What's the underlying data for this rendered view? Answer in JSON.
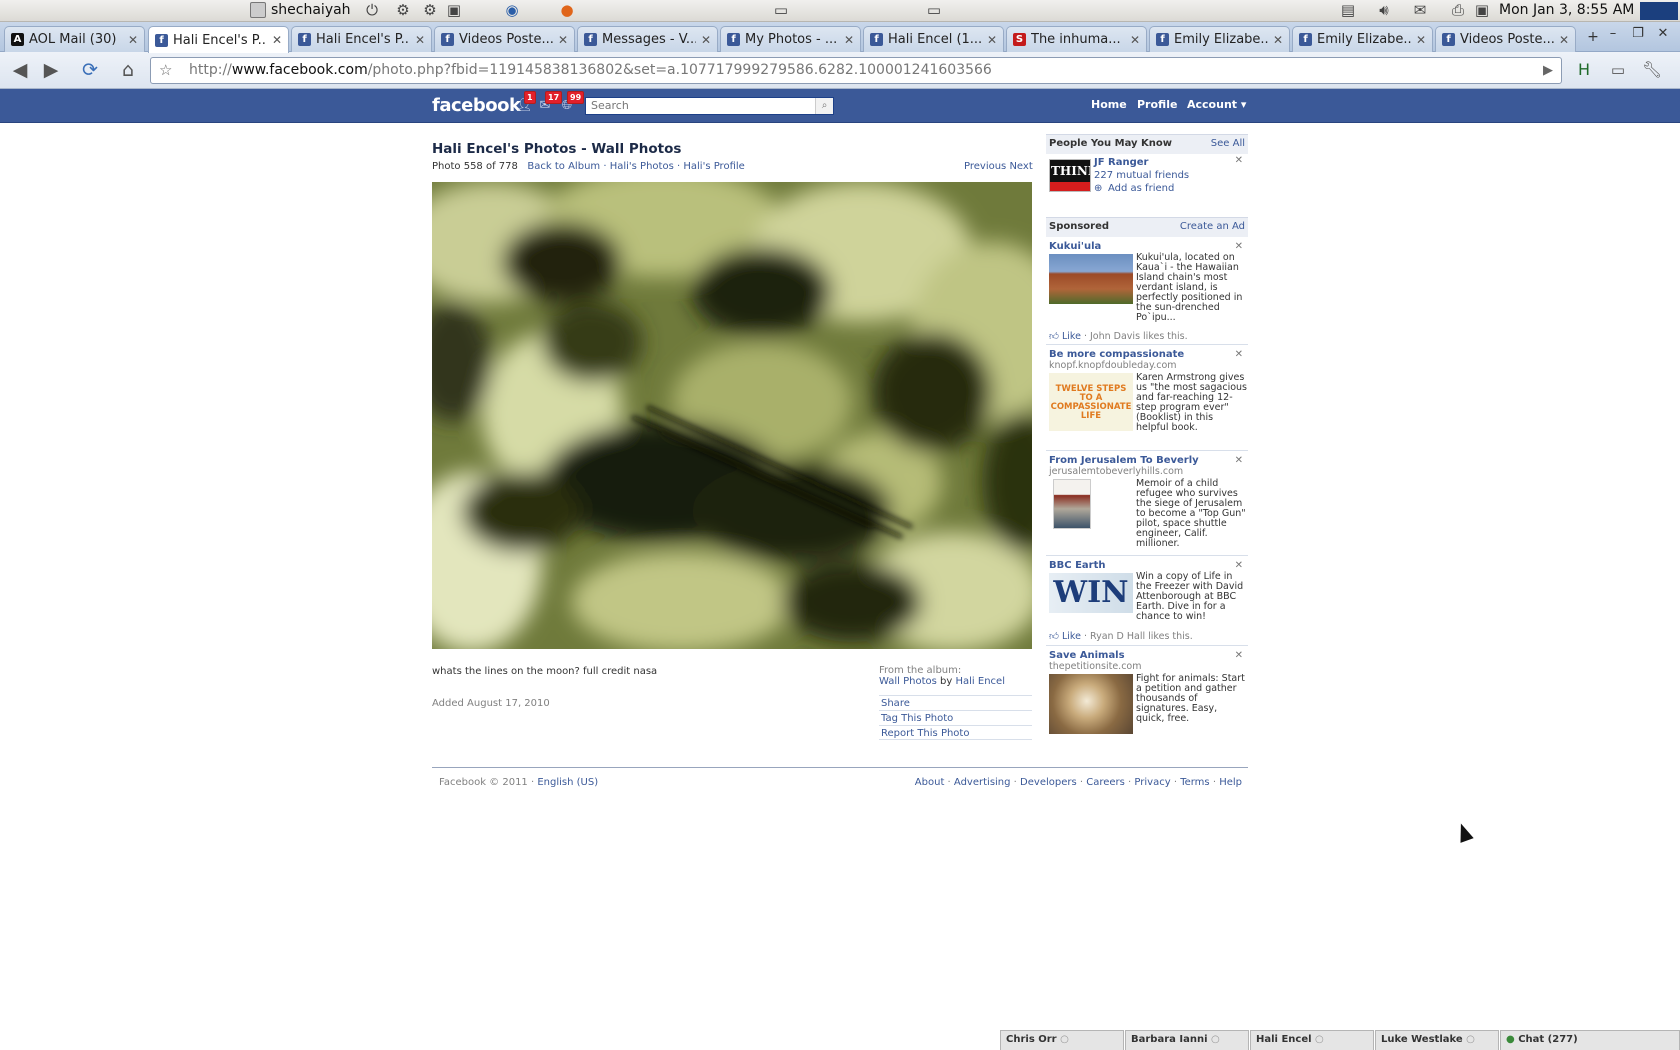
{
  "sysbar": {
    "username": "shechaiyah",
    "clock": "Mon Jan  3,  8:55 AM"
  },
  "tabs": [
    {
      "title": "AOL Mail (30)",
      "icon": "aol"
    },
    {
      "title": "Hali Encel's P...",
      "icon": "fb",
      "active": true
    },
    {
      "title": "Hali Encel's P...",
      "icon": "fb"
    },
    {
      "title": "Videos Poste...",
      "icon": "fb"
    },
    {
      "title": "Messages - V...",
      "icon": "fb"
    },
    {
      "title": "My Photos - ...",
      "icon": "fb"
    },
    {
      "title": "Hali Encel (1...",
      "icon": "fb"
    },
    {
      "title": "The inhuma...",
      "icon": "red"
    },
    {
      "title": "Emily Elizabe...",
      "icon": "fb"
    },
    {
      "title": "Emily Elizabe...",
      "icon": "fb"
    },
    {
      "title": "Videos Poste...",
      "icon": "fb"
    }
  ],
  "address": {
    "scheme": "http://",
    "host": "www.facebook.com",
    "path": "/photo.php?fbid=119145838136802&set=a.107717999279586.6282.100001241603566"
  },
  "fb": {
    "logo": "facebook",
    "badges": {
      "friends": "1",
      "messages": "17",
      "notifications": "99"
    },
    "search_placeholder": "Search",
    "nav": {
      "home": "Home",
      "profile": "Profile",
      "account": "Account ▾"
    }
  },
  "photo": {
    "title": "Hali Encel's Photos - Wall Photos",
    "counter": "Photo 558 of 778",
    "back_to_album": "Back to Album",
    "sep": "·",
    "halis_photos": "Hali's Photos",
    "halis_profile": "Hali's Profile",
    "previous": "Previous",
    "next": "Next",
    "caption": "whats the lines on the moon? full credit nasa",
    "added": "Added August 17, 2010",
    "from_album_label": "From the album:",
    "album_name": "Wall Photos",
    "by": "by",
    "album_owner": "Hali Encel",
    "actions": {
      "share": "Share",
      "tag": "Tag This Photo",
      "report": "Report This Photo"
    }
  },
  "sidebar": {
    "pymk_title": "People You May Know",
    "see_all": "See All",
    "person": {
      "name": "JF Ranger",
      "mutual": "227 mutual friends",
      "add": "Add as friend",
      "thumb_text": "THINK"
    },
    "sponsored_title": "Sponsored",
    "create_ad": "Create an Ad",
    "ads": [
      {
        "title": "Kukui'ula",
        "domain": "",
        "text": "Kukui'ula, located on Kaua`i - the Hawaiian Island chain's most verdant island, is perfectly positioned in the sun-drenched Po`ipu...",
        "like": "Like",
        "likes_text": "· John Davis likes this."
      },
      {
        "title": "Be more compassionate",
        "domain": "knopf.knopfdoubleday.com",
        "text": "Karen Armstrong gives us \"the most sagacious and far-reaching 12-step program ever\" (Booklist) in this helpful book.",
        "thumb_text": "TWELVE STEPS TO A COMPASSIONATE LIFE"
      },
      {
        "title": "From Jerusalem To Beverly",
        "domain": "jerusalemtobeverlyhills.com",
        "text": "Memoir of a child refugee who survives the siege of Jerusalem to become a \"Top Gun\" pilot, space shuttle engineer, Calif. millioner."
      },
      {
        "title": "BBC Earth",
        "domain": "",
        "text": "Win a copy of Life in the Freezer with David Attenborough at BBC Earth. Dive in for a chance to win!",
        "like": "Like",
        "likes_text": "· Ryan D Hall likes this.",
        "thumb_text": "WIN"
      },
      {
        "title": "Save Animals",
        "domain": "thepetitionsite.com",
        "text": "Fight for animals: Start a petition and gather thousands of signatures. Easy, quick, free."
      }
    ]
  },
  "footer": {
    "copyright": "Facebook © 2011 ·",
    "language": "English (US)",
    "links": [
      "About",
      "Advertising",
      "Developers",
      "Careers",
      "Privacy",
      "Terms",
      "Help"
    ]
  },
  "chat": {
    "friends": [
      "Chris Orr",
      "Barbara Ianni",
      "Hali Encel",
      "Luke Westlake"
    ],
    "chat_label": "Chat (277)"
  }
}
